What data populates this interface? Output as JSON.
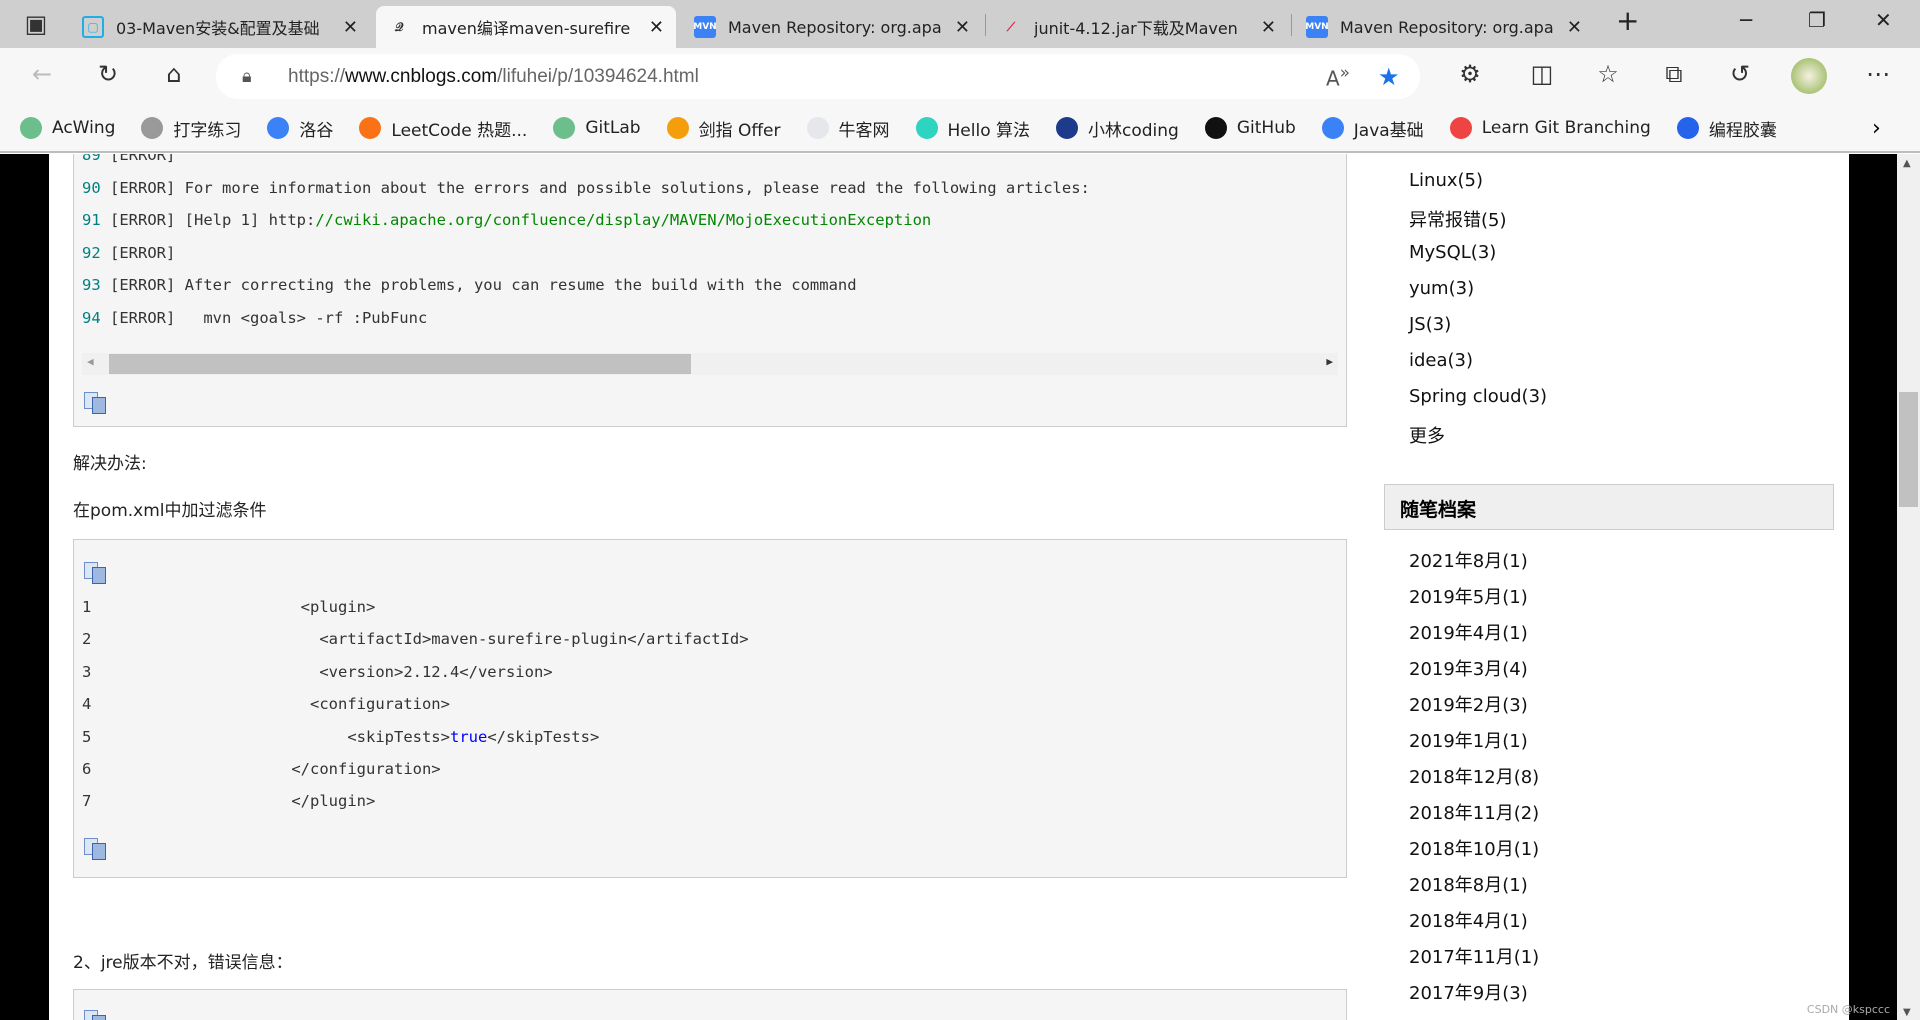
{
  "browser": {
    "tabs": [
      {
        "title": "03-Maven安装&配置及基础",
        "icon": "bilibili-icon",
        "active": false
      },
      {
        "title": "maven编译maven-surefire",
        "icon": "cnblogs-icon",
        "active": true
      },
      {
        "title": "Maven Repository: org.apa",
        "icon": "mvn-icon",
        "active": false
      },
      {
        "title": "junit-4.12.jar下载及Maven",
        "icon": "jar-icon",
        "active": false
      },
      {
        "title": "Maven Repository: org.apa",
        "icon": "mvn-icon",
        "active": false
      }
    ],
    "url_prefix": "https://",
    "url_host": "www.cnblogs.com",
    "url_path": "/lifuhei/p/10394624.html",
    "bookmarks": [
      {
        "label": "AcWing",
        "color": "#6cbf8c"
      },
      {
        "label": "打字练习",
        "color": "#999999"
      },
      {
        "label": "洛谷",
        "color": "#3b82f6"
      },
      {
        "label": "LeetCode 热题...",
        "color": "#f97316"
      },
      {
        "label": "GitLab",
        "color": "#6cbf8c"
      },
      {
        "label": "剑指 Offer",
        "color": "#f59e0b"
      },
      {
        "label": "牛客网",
        "color": "#e5e7eb"
      },
      {
        "label": "Hello 算法",
        "color": "#2dd4bf"
      },
      {
        "label": "小林coding",
        "color": "#1e3a8a"
      },
      {
        "label": "GitHub",
        "color": "#111111"
      },
      {
        "label": "Java基础",
        "color": "#3b82f6"
      },
      {
        "label": "Learn Git Branching",
        "color": "#ef4444"
      },
      {
        "label": "编程胶囊",
        "color": "#2563eb"
      }
    ]
  },
  "code1": {
    "lines": [
      {
        "n": "89",
        "text": "[ERROR]",
        "link": ""
      },
      {
        "n": "90",
        "text": "[ERROR] For more information about the errors and possible solutions, please read the following articles:",
        "link": ""
      },
      {
        "n": "91",
        "text": "[ERROR] [Help 1] http:",
        "link": "//cwiki.apache.org/confluence/display/MAVEN/MojoExecutionException"
      },
      {
        "n": "92",
        "text": "[ERROR]",
        "link": ""
      },
      {
        "n": "93",
        "text": "[ERROR] After correcting the problems, you can resume the build with the command",
        "link": ""
      },
      {
        "n": "94",
        "text": "[ERROR]   mvn <goals> -rf :PubFunc",
        "link": ""
      }
    ],
    "scroll_position": 0
  },
  "solution_label": "解决办法:",
  "solution_text": "在pom.xml中加过滤条件",
  "code2": {
    "lines": [
      {
        "n": "1",
        "pre": "  <plugin>",
        "kw": "",
        "post": ""
      },
      {
        "n": "2",
        "pre": "    <artifactId>maven-surefire-plugin</artifactId>",
        "kw": "",
        "post": ""
      },
      {
        "n": "3",
        "pre": "    <version>2.12.4</version>",
        "kw": "",
        "post": ""
      },
      {
        "n": "4",
        "pre": "   <configuration>",
        "kw": "",
        "post": ""
      },
      {
        "n": "5",
        "pre": "       <skipTests>",
        "kw": "true",
        "post": "</skipTests>"
      },
      {
        "n": "6",
        "pre": " </configuration>",
        "kw": "",
        "post": ""
      },
      {
        "n": "7",
        "pre": " </plugin>",
        "kw": "",
        "post": ""
      }
    ]
  },
  "section2_title": "2、jre版本不对，错误信息：",
  "sidebar": {
    "categories": [
      "Linux(5)",
      "异常报错(5)",
      "MySQL(3)",
      "yum(3)",
      "JS(3)",
      "idea(3)",
      "Spring cloud(3)",
      "更多"
    ],
    "archive_title": "随笔档案",
    "archives": [
      "2021年8月(1)",
      "2019年5月(1)",
      "2019年4月(1)",
      "2019年3月(4)",
      "2019年2月(3)",
      "2019年1月(1)",
      "2018年12月(8)",
      "2018年11月(2)",
      "2018年10月(1)",
      "2018年8月(1)",
      "2018年4月(1)",
      "2017年11月(1)",
      "2017年9月(3)"
    ]
  },
  "watermark": "CSDN @kspccc"
}
